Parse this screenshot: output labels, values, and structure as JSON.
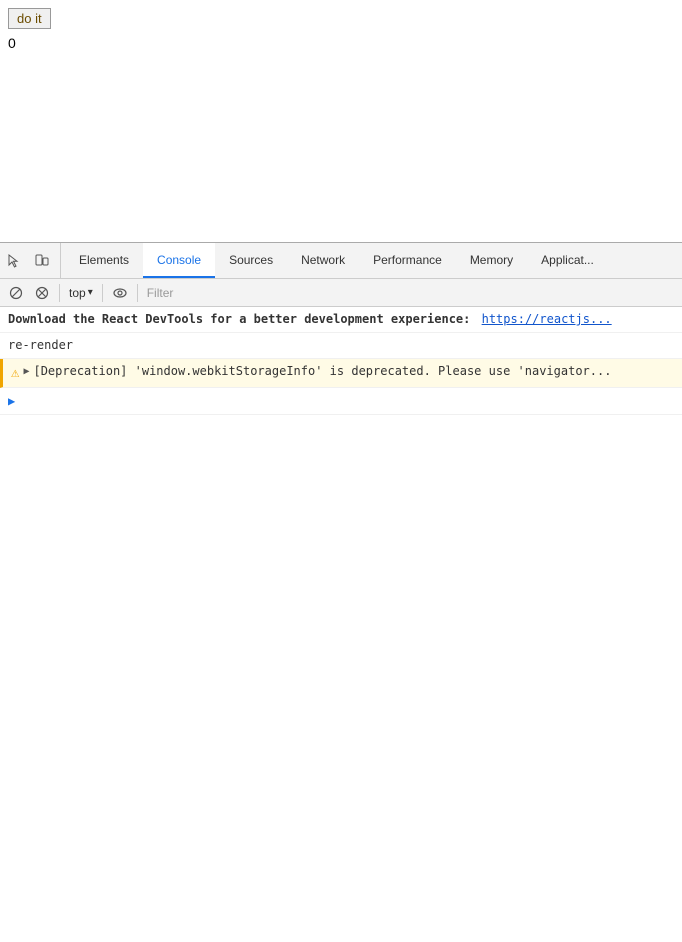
{
  "page": {
    "button_label": "do it",
    "counter_value": "0"
  },
  "devtools": {
    "tabs": [
      {
        "id": "elements",
        "label": "Elements",
        "active": false
      },
      {
        "id": "console",
        "label": "Console",
        "active": true
      },
      {
        "id": "sources",
        "label": "Sources",
        "active": false
      },
      {
        "id": "network",
        "label": "Network",
        "active": false
      },
      {
        "id": "performance",
        "label": "Performance",
        "active": false
      },
      {
        "id": "memory",
        "label": "Memory",
        "active": false
      },
      {
        "id": "application",
        "label": "Applicat...",
        "active": false
      }
    ],
    "toolbar": {
      "top_label": "top",
      "filter_placeholder": "Filter"
    },
    "console_messages": [
      {
        "type": "info",
        "text": "Download the React DevTools for a better development experience: ",
        "link": "https://reactjs...",
        "bold": true
      },
      {
        "type": "text",
        "text": "re-render"
      },
      {
        "type": "warning",
        "text": "[Deprecation] 'window.webkitStorageInfo' is deprecated. Please use 'navigator..."
      },
      {
        "type": "prompt",
        "text": ""
      }
    ]
  }
}
